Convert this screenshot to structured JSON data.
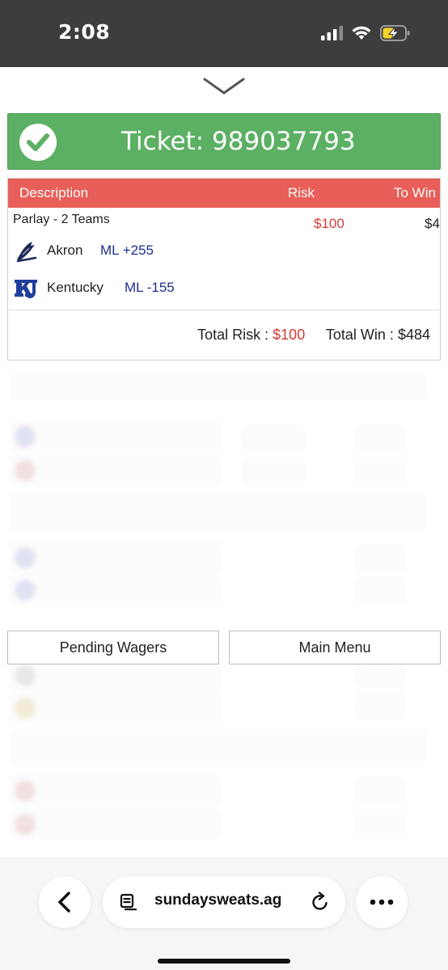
{
  "status_bar": {
    "time": "2:08",
    "icons": [
      "cellular-signal-icon",
      "wifi-icon",
      "battery-charging-icon"
    ]
  },
  "ticket": {
    "label": "Ticket:",
    "number": "989037793",
    "icon": "check-circle-icon",
    "color": "#5cb064"
  },
  "table": {
    "header": {
      "description": "Description",
      "risk": "Risk",
      "to_win": "To Win",
      "color": "#e85e58"
    },
    "parlay": {
      "label": "Parlay - 2 Teams",
      "risk": "$100",
      "to_win": "$4"
    },
    "legs": [
      {
        "team": "Akron",
        "line": "ML +255",
        "logo": "akron-zips-logo"
      },
      {
        "team": "Kentucky",
        "line": "ML -155",
        "logo": "kentucky-wildcats-logo"
      }
    ],
    "totals": {
      "risk_label": "Total Risk :",
      "risk_value": "$100",
      "win_label": "Total Win :",
      "win_value": "$484"
    }
  },
  "buttons": {
    "pending": "Pending Wagers",
    "main_menu": "Main Menu"
  },
  "browser": {
    "url": "sundaysweats.ag",
    "icons": [
      "back-arrow-icon",
      "reader-mode-icon",
      "reload-icon",
      "more-icon"
    ]
  }
}
